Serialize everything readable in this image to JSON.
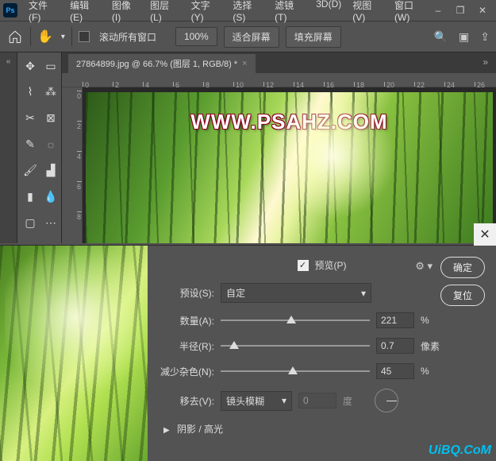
{
  "window": {
    "minimize": "–",
    "restore": "❐",
    "close": "✕"
  },
  "menu": [
    "文件(F)",
    "编辑(E)",
    "图像(I)",
    "图层(L)",
    "文字(Y)",
    "选择(S)",
    "滤镜(T)",
    "3D(D)",
    "视图(V)",
    "窗口(W)"
  ],
  "options": {
    "scroll_all": "滚动所有窗口",
    "zoom": "100%",
    "fit_screen": "适合屏幕",
    "fill_screen": "填充屏幕"
  },
  "document": {
    "tab": "27864899.jpg @ 66.7% (图层 1, RGB/8) *",
    "watermark": "WWW.PSAHZ.COM"
  },
  "ruler_h": [
    0,
    2,
    4,
    6,
    8,
    10,
    12,
    14,
    16,
    18,
    20,
    22,
    24,
    26
  ],
  "ruler_v": [
    0,
    2,
    4,
    6,
    8
  ],
  "dialog": {
    "preview_label": "预览(P)",
    "ok": "确定",
    "reset": "复位",
    "preset_label": "预设(S):",
    "preset_value": "自定",
    "amount_label": "数量(A):",
    "amount_value": "221",
    "amount_unit": "%",
    "radius_label": "半径(R):",
    "radius_value": "0.7",
    "radius_unit": "像素",
    "noise_label": "减少杂色(N):",
    "noise_value": "45",
    "noise_unit": "%",
    "remove_label": "移去(V):",
    "remove_value": "镜头模糊",
    "angle_value": "0",
    "angle_unit": "度",
    "shadows": "阴影 / 高光"
  },
  "footer_watermark": "UiBQ.CoM"
}
